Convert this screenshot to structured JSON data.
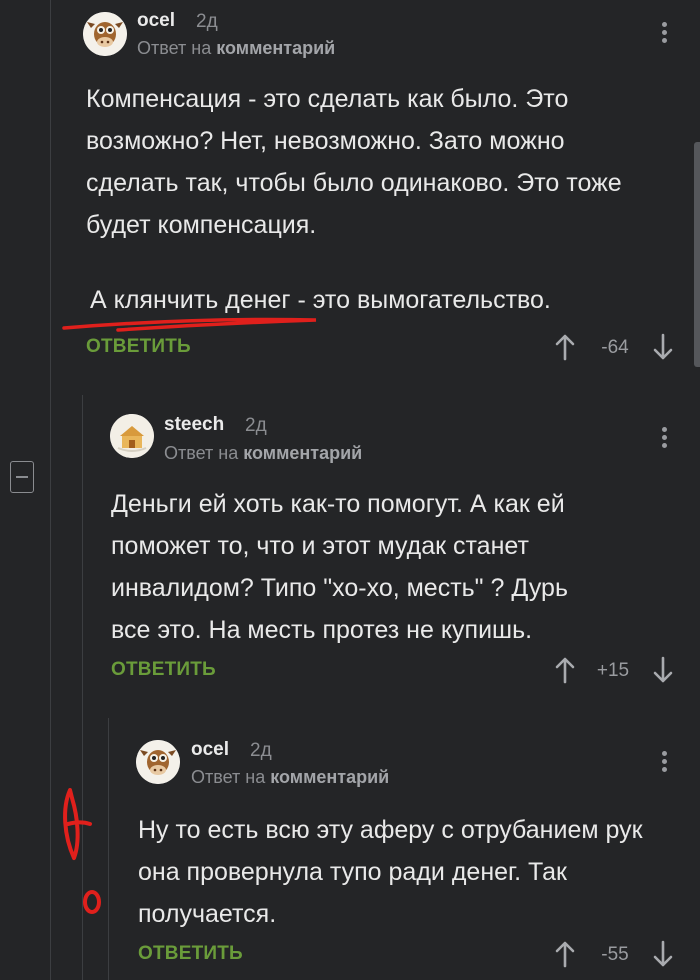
{
  "reply_prefix": "Ответ на",
  "reply_target": "комментарий",
  "reply_label": "ОТВЕТИТЬ",
  "comments": [
    {
      "username": "ocel",
      "time": "2д",
      "paragraphs": [
        "Компенсация - это сделать как было. Это возможно? Нет, невозможно. Зато можно сделать так, чтобы было одинаково. Это тоже будет компенсация.",
        "А клянчить денег - это вымогательство."
      ],
      "rating": "-64"
    },
    {
      "username": "steech",
      "time": "2д",
      "paragraphs": [
        "Деньги ей хоть как-то помогут. А как ей поможет то, что и этот мудак станет инвалидом? Типо \"хо-хо, месть\" ? Дурь все это. На месть протез не купишь."
      ],
      "rating": "+15"
    },
    {
      "username": "ocel",
      "time": "2д",
      "paragraphs": [
        "Ну то есть всю эту аферу с отрубанием рук она провернула тупо ради денег. Так получается."
      ],
      "rating": "-55"
    }
  ],
  "colors": {
    "background": "#242527",
    "accent_reply": "#6a9c3a",
    "annotation_red": "#e0201c"
  },
  "icons": [
    "collapse-thread-icon",
    "more-menu-icon",
    "vote-up-icon",
    "vote-down-icon",
    "cow-avatar-icon",
    "house-avatar-icon"
  ]
}
